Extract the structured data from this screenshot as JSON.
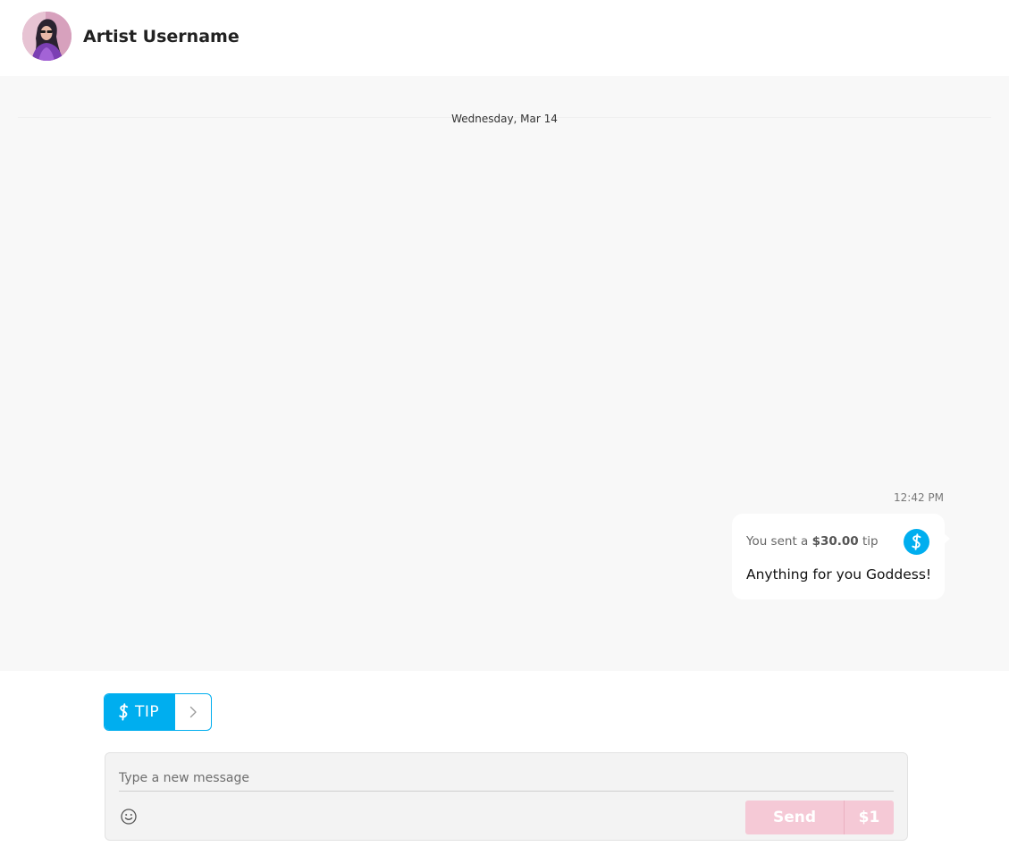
{
  "header": {
    "username": "Artist Username"
  },
  "conversation": {
    "date_label": "Wednesday, Mar 14",
    "messages": [
      {
        "timestamp": "12:42 PM",
        "tip_prefix": "You sent a ",
        "tip_amount": "$30.00",
        "tip_suffix": " tip",
        "text": "Anything for you Goddess!",
        "icon": "dollar-tip-icon"
      }
    ]
  },
  "tip_button": {
    "label": "TIP",
    "icon": "dollar-icon",
    "expand_icon": "chevron-right-icon"
  },
  "composer": {
    "placeholder": "Type a new message",
    "value": "",
    "emoji_icon": "smiley-icon",
    "send_label": "Send",
    "price_label": "$1"
  },
  "colors": {
    "accent": "#00aeef",
    "send_disabled": "#f5c9d6",
    "conversation_bg": "#f8f8f8"
  }
}
